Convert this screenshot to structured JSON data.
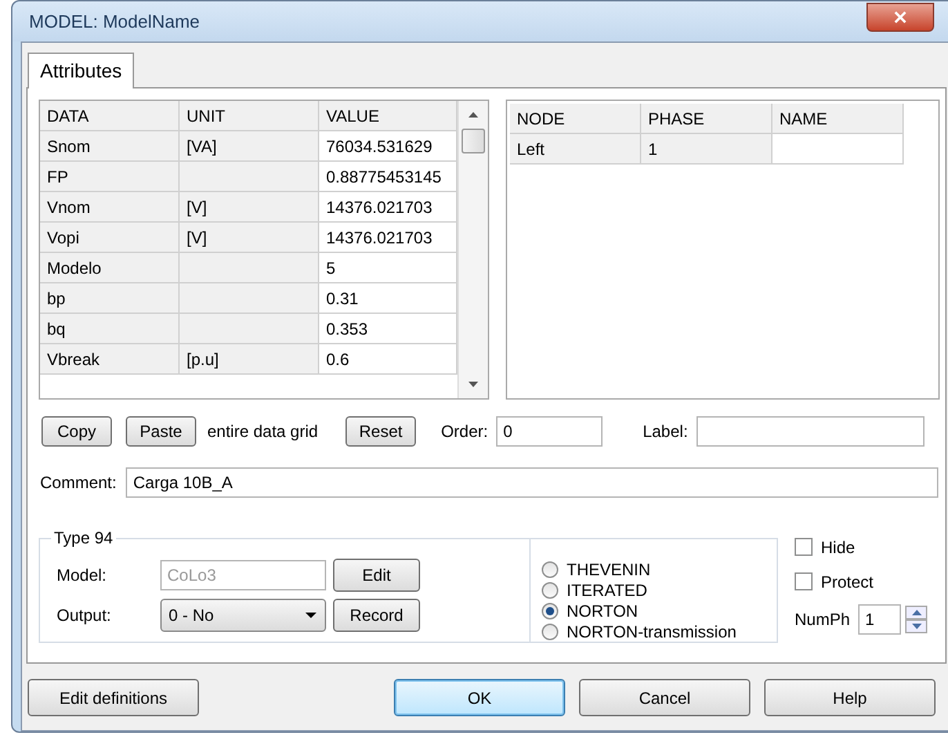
{
  "window": {
    "title": "MODEL: ModelName"
  },
  "tabs": [
    {
      "label": "Attributes",
      "selected": true
    }
  ],
  "data_grid": {
    "columns": [
      "DATA",
      "UNIT",
      "VALUE"
    ],
    "rows": [
      [
        "Snom",
        "[VA]",
        "76034.531629"
      ],
      [
        "FP",
        "",
        "0.88775453145"
      ],
      [
        "Vnom",
        "[V]",
        "14376.021703"
      ],
      [
        "Vopi",
        "[V]",
        "14376.021703"
      ],
      [
        "Modelo",
        "",
        "5"
      ],
      [
        "bp",
        "",
        "0.31"
      ],
      [
        "bq",
        "",
        "0.353"
      ],
      [
        "Vbreak",
        "[p.u]",
        "0.6"
      ]
    ]
  },
  "node_grid": {
    "columns": [
      "NODE",
      "PHASE",
      "NAME"
    ],
    "rows": [
      [
        "Left",
        "1"
      ]
    ]
  },
  "grid_actions": {
    "copy_button": "Copy",
    "paste_button": "Paste",
    "note": "entire data grid",
    "reset_button": "Reset"
  },
  "order": {
    "label": "Order:",
    "value": "0"
  },
  "label_field": {
    "label": "Label:"
  },
  "comment": {
    "label": "Comment:",
    "value": "Carga 10B_A"
  },
  "type_group": {
    "title": "Type 94",
    "model": {
      "label": "Model:",
      "value": "CoLo3",
      "disabled": true
    },
    "edit_button": "Edit",
    "output": {
      "label": "Output:",
      "value": "0 - No"
    },
    "record_button": "Record"
  },
  "solver_options": [
    {
      "label": "THEVENIN",
      "selected": false
    },
    {
      "label": "ITERATED",
      "selected": false
    },
    {
      "label": "NORTON",
      "selected": true
    },
    {
      "label": "NORTON-transmission",
      "selected": false
    }
  ],
  "checkboxes": [
    {
      "label": "Hide",
      "checked": false
    },
    {
      "label": "Protect",
      "checked": false
    }
  ],
  "numph": {
    "label": "NumPh",
    "value": "1"
  },
  "footer_buttons": [
    {
      "label": "Edit definitions",
      "default": false
    },
    {
      "label": "OK",
      "default": true
    },
    {
      "label": "Cancel",
      "default": false
    },
    {
      "label": "Help",
      "default": false
    }
  ]
}
